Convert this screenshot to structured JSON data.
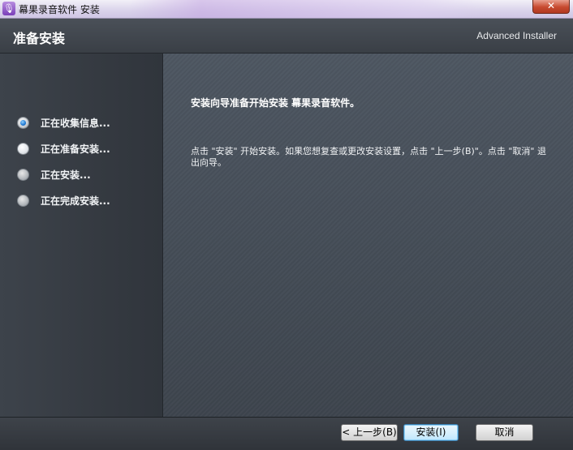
{
  "window": {
    "title": "幕果录音软件 安装",
    "app_icon": "microphone-icon",
    "close_glyph": "✕"
  },
  "header": {
    "title": "准备安装",
    "brand": "Advanced Installer"
  },
  "sidebar": {
    "steps": [
      {
        "label": "正在收集信息...",
        "state": "done"
      },
      {
        "label": "正在准备安装...",
        "state": "current"
      },
      {
        "label": "正在安装...",
        "state": "pending"
      },
      {
        "label": "正在完成安装...",
        "state": "pending"
      }
    ]
  },
  "content": {
    "heading": "安装向导准备开始安装 幕果录音软件。",
    "body": "点击 \"安装\" 开始安装。如果您想复查或更改安装设置，点击 \"上一步(B)\"。点击 \"取消\" 退出向导。"
  },
  "footer": {
    "back_label": "< 上一步(B)",
    "install_label": "安装(I)",
    "cancel_label": "取消"
  },
  "colors": {
    "header_bg": "#42474f",
    "sidebar_bg": "#3a4048",
    "content_bg": "#48515b",
    "active_radio": "#1e78d2"
  }
}
